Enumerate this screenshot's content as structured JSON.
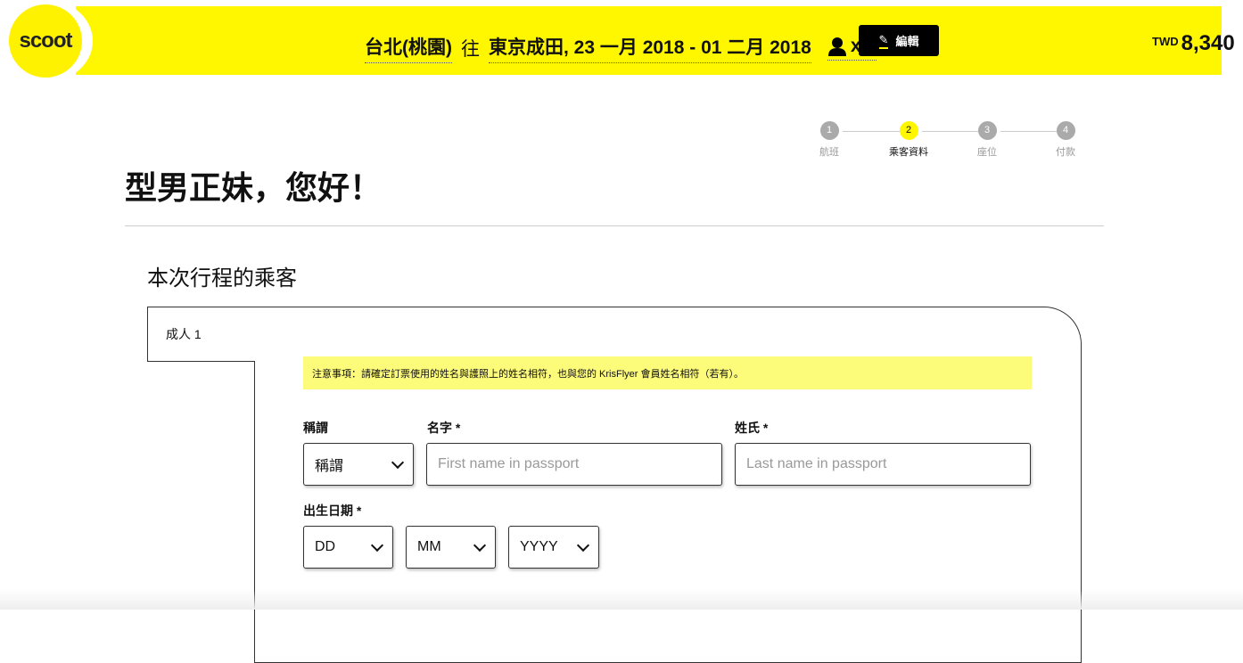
{
  "header": {
    "logo": "scoot",
    "origin": "台北(桃園)",
    "to": "往",
    "destination_dates": "東京成田, 23 一月 2018 - 01 二月 2018",
    "passengers": "x 1",
    "edit_label": "編輯",
    "currency": "TWD",
    "price": "8,340"
  },
  "stepper": [
    {
      "num": "1",
      "label": "航班"
    },
    {
      "num": "2",
      "label": "乘客資料",
      "active": true
    },
    {
      "num": "3",
      "label": "座位"
    },
    {
      "num": "4",
      "label": "付款"
    }
  ],
  "title": "型男正妹，您好！",
  "section_title": "本次行程的乘客",
  "passenger_tab": "成人 1",
  "notice": "注意事項：請確定訂票使用的姓名與護照上的姓名相符，也與您的 KrisFlyer 會員姓名相符（若有）。",
  "form": {
    "salutation_label": "稱謂",
    "salutation_value": "稱謂",
    "first_label": "名字 *",
    "first_placeholder": "First name in passport",
    "last_label": "姓氏 *",
    "last_placeholder": "Last name in passport",
    "dob_label": "出生日期 *",
    "day": "DD",
    "month": "MM",
    "year": "YYYY"
  },
  "colors": {
    "brand": "#fff700",
    "notice": "#fdfb7a"
  }
}
